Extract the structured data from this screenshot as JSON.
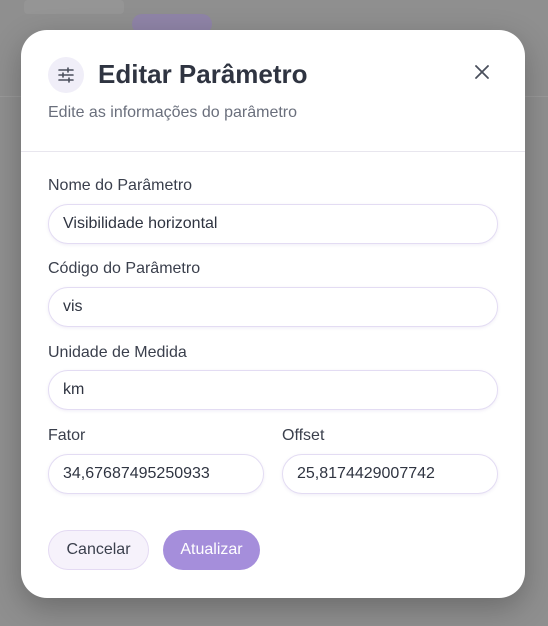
{
  "modal": {
    "title": "Editar Parâmetro",
    "subtitle": "Edite as informações do parâmetro",
    "header_icon": "sliders-icon",
    "close_icon": "close-icon"
  },
  "form": {
    "name": {
      "label": "Nome do Parâmetro",
      "value": "Visibilidade horizontal"
    },
    "code": {
      "label": "Código do Parâmetro",
      "value": "vis"
    },
    "unit": {
      "label": "Unidade de Medida",
      "value": "km"
    },
    "factor": {
      "label": "Fator",
      "value": "34,67687495250933"
    },
    "offset": {
      "label": "Offset",
      "value": "25,8174429007742"
    }
  },
  "actions": {
    "cancel_label": "Cancelar",
    "update_label": "Atualizar"
  },
  "colors": {
    "accent": "#a58edb",
    "backdrop": "#8f8f8f"
  }
}
